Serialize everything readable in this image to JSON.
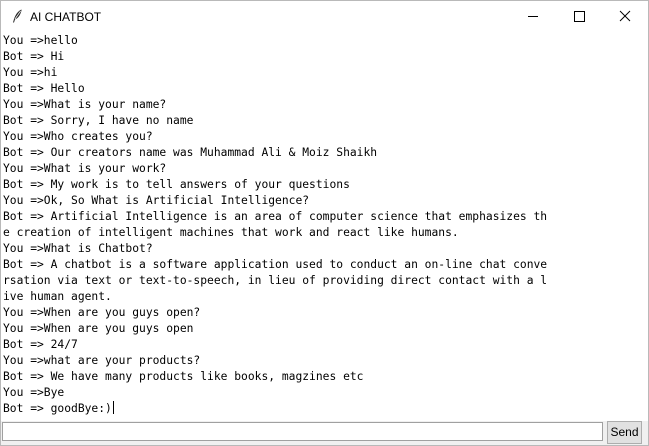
{
  "window": {
    "title": "AI CHATBOT",
    "icon": "feather-icon",
    "controls": {
      "minimize_icon": "minimize-icon",
      "maximize_icon": "maximize-icon",
      "close_icon": "close-icon"
    }
  },
  "chat": {
    "lines": [
      "You =>hello",
      "Bot => Hi",
      "You =>hi",
      "Bot => Hello",
      "You =>What is your name?",
      "Bot => Sorry, I have no name",
      "You =>Who creates you?",
      "Bot => Our creators name was Muhammad Ali & Moiz Shaikh",
      "You =>What is your work?",
      "Bot => My work is to tell answers of your questions",
      "You =>Ok, So What is Artificial Intelligence?",
      "Bot => Artificial Intelligence is an area of computer science that emphasizes th",
      "e creation of intelligent machines that work and react like humans.",
      "You =>What is Chatbot?",
      "Bot => A chatbot is a software application used to conduct an on-line chat conve",
      "rsation via text or text-to-speech, in lieu of providing direct contact with a l",
      "ive human agent.",
      "You =>When are you guys open?",
      "You =>When are you guys open",
      "Bot => 24/7",
      "You =>what are your products?",
      "Bot => We have many products like books, magzines etc",
      "You =>Bye",
      "Bot => goodBye:)"
    ]
  },
  "input": {
    "value": "",
    "send_label": "Send"
  }
}
